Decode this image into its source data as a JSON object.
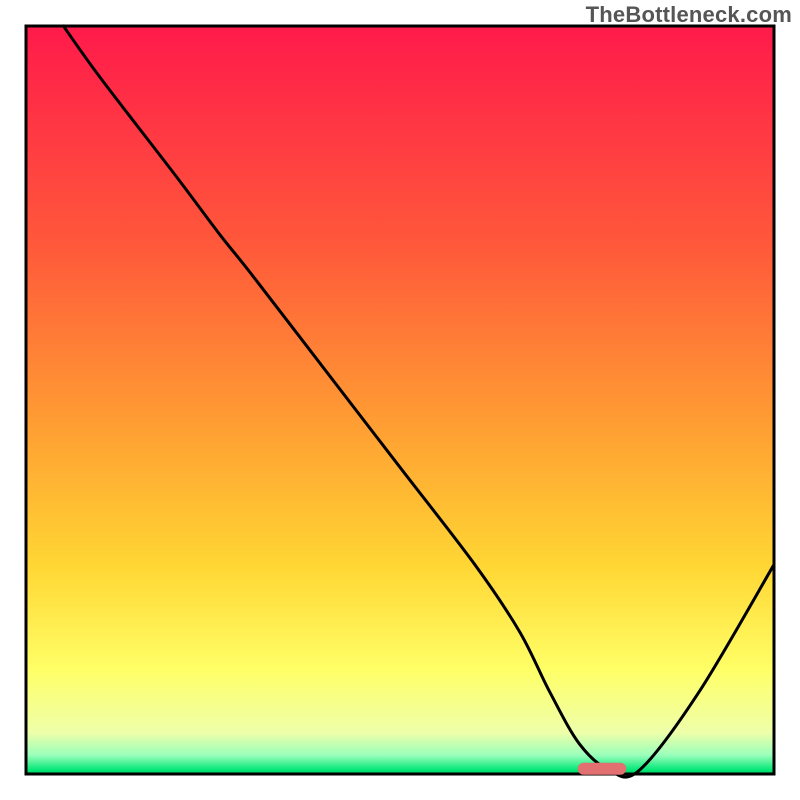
{
  "watermark": "TheBottleneck.com",
  "chart_data": {
    "type": "line",
    "title": "",
    "xlabel": "",
    "ylabel": "",
    "xlim": [
      0,
      100
    ],
    "ylim": [
      0,
      100
    ],
    "grid": false,
    "legend": false,
    "background_gradient_stops": [
      {
        "offset": 0,
        "color": "#ff1a4b"
      },
      {
        "offset": 0.3,
        "color": "#ff5a3a"
      },
      {
        "offset": 0.52,
        "color": "#ff9a33"
      },
      {
        "offset": 0.72,
        "color": "#ffd633"
      },
      {
        "offset": 0.86,
        "color": "#ffff66"
      },
      {
        "offset": 0.945,
        "color": "#eeffaa"
      },
      {
        "offset": 0.975,
        "color": "#99ffbb"
      },
      {
        "offset": 0.995,
        "color": "#00e676"
      },
      {
        "offset": 1.0,
        "color": "#00c853"
      }
    ],
    "series": [
      {
        "name": "bottleneck-curve",
        "x": [
          5,
          10,
          20,
          26,
          30,
          40,
          50,
          60,
          66,
          70,
          74,
          78,
          82,
          90,
          100
        ],
        "y": [
          100,
          93,
          80,
          72,
          67,
          54,
          41,
          28,
          19,
          11,
          4,
          0.5,
          0.5,
          11,
          28
        ]
      }
    ],
    "marker": {
      "name": "optimal-zone",
      "shape": "rounded-rect",
      "x_center": 77,
      "y_center": 0.7,
      "width": 6.5,
      "height": 1.6,
      "color": "#e27070"
    }
  }
}
